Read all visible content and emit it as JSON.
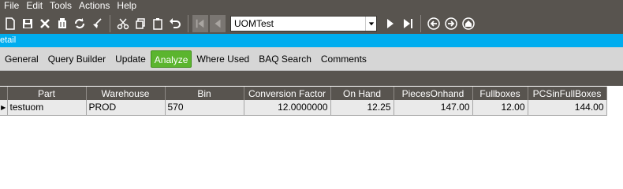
{
  "menu": [
    "File",
    "Edit",
    "Tools",
    "Actions",
    "Help"
  ],
  "toolbar": {
    "key_combo_value": "UOMTest",
    "icons": [
      "new-icon",
      "save-icon",
      "delete-icon",
      "clear-icon",
      "refresh-icon",
      "clear-broom-icon",
      "cut-icon",
      "copy-icon",
      "paste-icon",
      "undo-icon",
      "first-record-icon",
      "prev-record-icon",
      "next-record-icon",
      "last-record-icon",
      "back-icon",
      "forward-icon",
      "home-icon"
    ]
  },
  "window": {
    "title": "etail"
  },
  "tabs": [
    {
      "label": "General",
      "active": false
    },
    {
      "label": "Query Builder",
      "active": false
    },
    {
      "label": "Update",
      "active": false
    },
    {
      "label": "Analyze",
      "active": true
    },
    {
      "label": "Where Used",
      "active": false
    },
    {
      "label": "BAQ Search",
      "active": false
    },
    {
      "label": "Comments",
      "active": false
    }
  ],
  "grid": {
    "columns": [
      "Part",
      "Warehouse",
      "Bin",
      "Conversion Factor",
      "On Hand",
      "PiecesOnhand",
      "Fullboxes",
      "PCSinFullBoxes"
    ],
    "rows": [
      [
        "testuom",
        "PROD",
        "570",
        "12.0000000",
        "12.25",
        "147.00",
        "12.00",
        "144.00"
      ]
    ]
  },
  "colors": {
    "chrome": "#58544f",
    "accent": "#00adef",
    "active_tab": "#5bb52e"
  }
}
